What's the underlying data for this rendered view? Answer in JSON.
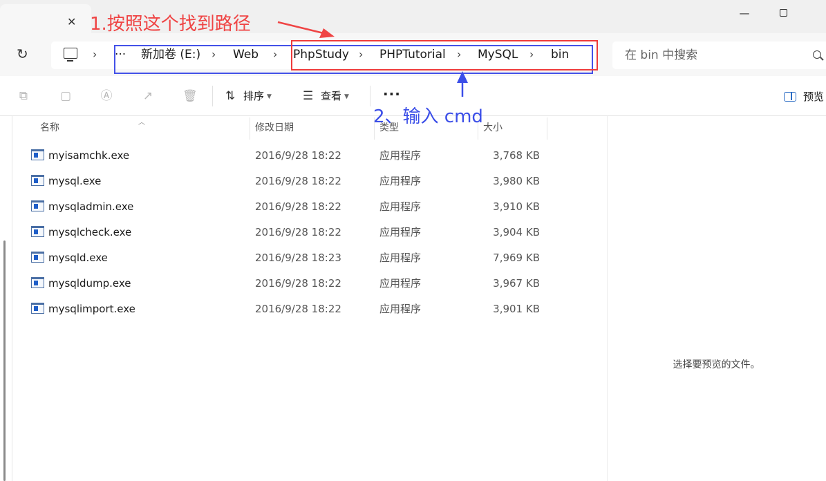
{
  "tab": {
    "close_glyph": "✕"
  },
  "window_controls": {
    "minimize_glyph": "—"
  },
  "address": {
    "overflow": "···",
    "separator": "›",
    "crumbs": [
      "新加卷 (E:)",
      "Web",
      "PhpStudy",
      "PHPTutorial",
      "MySQL",
      "bin"
    ]
  },
  "search": {
    "placeholder": "在 bin 中搜索"
  },
  "toolbar": {
    "sort_label": "排序",
    "view_label": "查看",
    "more_label": "···",
    "preview_label": "预览"
  },
  "columns": {
    "name": "名称",
    "date": "修改日期",
    "type": "类型",
    "size": "大小"
  },
  "files": [
    {
      "name": "myisamchk.exe",
      "date": "2016/9/28 18:22",
      "type": "应用程序",
      "size": "3,768 KB"
    },
    {
      "name": "mysql.exe",
      "date": "2016/9/28 18:22",
      "type": "应用程序",
      "size": "3,980 KB"
    },
    {
      "name": "mysqladmin.exe",
      "date": "2016/9/28 18:22",
      "type": "应用程序",
      "size": "3,910 KB"
    },
    {
      "name": "mysqlcheck.exe",
      "date": "2016/9/28 18:22",
      "type": "应用程序",
      "size": "3,904 KB"
    },
    {
      "name": "mysqld.exe",
      "date": "2016/9/28 18:23",
      "type": "应用程序",
      "size": "7,969 KB"
    },
    {
      "name": "mysqldump.exe",
      "date": "2016/9/28 18:22",
      "type": "应用程序",
      "size": "3,967 KB"
    },
    {
      "name": "mysqlimport.exe",
      "date": "2016/9/28 18:22",
      "type": "应用程序",
      "size": "3,901 KB"
    }
  ],
  "preview_pane": {
    "message": "选择要预览的文件。"
  },
  "annotations": {
    "note1": "1.按照这个找到路径",
    "note2": "2、输入 cmd",
    "colors": {
      "red": "#ef4444",
      "blue": "#3b4ee8"
    }
  }
}
